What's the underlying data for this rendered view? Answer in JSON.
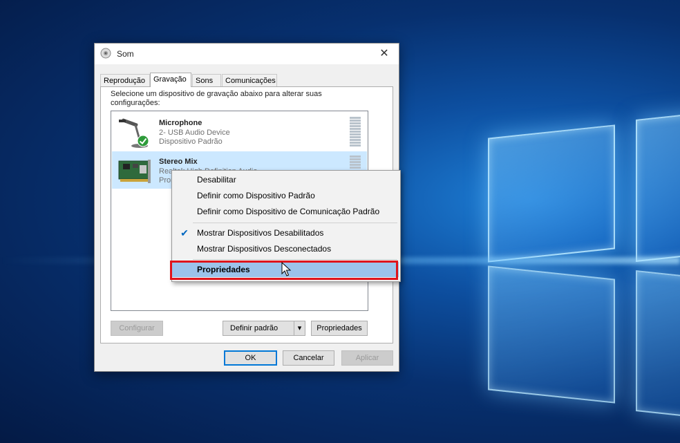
{
  "dialog": {
    "title": "Som",
    "close_label": "✕",
    "tabs": [
      {
        "label": "Reprodução"
      },
      {
        "label": "Gravação"
      },
      {
        "label": "Sons"
      },
      {
        "label": "Comunicações"
      }
    ],
    "active_tab": "Gravação",
    "instructions": "Selecione um dispositivo de gravação abaixo para alterar suas configurações:",
    "devices": [
      {
        "name": "Microphone",
        "line1": "2- USB Audio Device",
        "line2": "Dispositivo Padrão",
        "icon": "microphone-icon",
        "status_icon": "default-check-icon"
      },
      {
        "name": "Stereo Mix",
        "line1": "Realtek High Definition Audio",
        "line2": "Pronto",
        "icon": "sound-card-icon",
        "selected": true
      }
    ],
    "buttons": {
      "configurar": "Configurar",
      "definir_padrao": "Definir padrão",
      "dropdown_arrow": "▾",
      "propriedades": "Propriedades",
      "ok": "OK",
      "cancelar": "Cancelar",
      "aplicar": "Aplicar"
    }
  },
  "context_menu": {
    "items": [
      {
        "label": "Desabilitar"
      },
      {
        "label": "Definir como Dispositivo Padrão"
      },
      {
        "label": "Definir como Dispositivo de Comunicação Padrão"
      },
      {
        "label": "Mostrar Dispositivos Desabilitados",
        "checked": true,
        "check_glyph": "✔"
      },
      {
        "label": "Mostrar Dispositivos Desconectados"
      },
      {
        "label": "Propriedades",
        "highlighted": true
      }
    ]
  },
  "colors": {
    "highlight_box": "#e0141a",
    "menu_highlight": "#9cc3ea",
    "selection": "#cce8ff",
    "accent": "#0078d7"
  }
}
